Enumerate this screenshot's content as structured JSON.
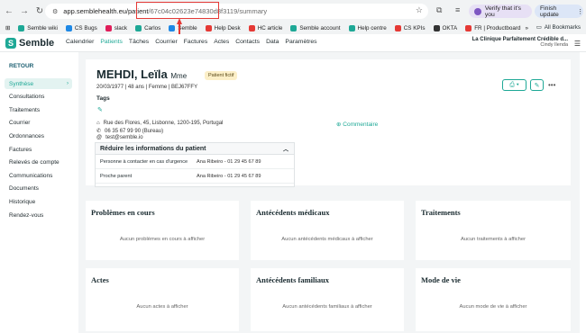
{
  "browser": {
    "url_host": "app.semblehealth.eu/patient",
    "url_path": "/67c04c02623e74830d8f3119/summary",
    "verify_label": "Verify that it's you",
    "finish_label": "Finish update",
    "bookmarks": [
      {
        "label": "Semble wiki",
        "color": "#1ea896"
      },
      {
        "label": "CS Bugs",
        "color": "#1e88e5"
      },
      {
        "label": "slack",
        "color": "#e01e5a"
      },
      {
        "label": "Carlos",
        "color": "#1ea896"
      },
      {
        "label": "Semble",
        "color": "#1e88e5"
      },
      {
        "label": "Help Desk",
        "color": "#e53935"
      },
      {
        "label": "HC article",
        "color": "#e53935"
      },
      {
        "label": "Semble account",
        "color": "#1ea896"
      },
      {
        "label": "Help centre",
        "color": "#1ea896"
      },
      {
        "label": "CS KPIs",
        "color": "#e53935"
      },
      {
        "label": "OKTA",
        "color": "#333333"
      },
      {
        "label": "FR | Productboard",
        "color": "#e53935"
      }
    ],
    "all_bookmarks": "All Bookmarks"
  },
  "app": {
    "logo": "Semble",
    "nav": [
      "Calendrier",
      "Patients",
      "Tâches",
      "Courrier",
      "Factures",
      "Actes",
      "Contacts",
      "Data",
      "Paramètres"
    ],
    "active_nav": "Patients",
    "clinic_name": "La Clinique Parfaitement Crédible d...",
    "clinic_user": "Cindy Ilenda"
  },
  "sidebar": {
    "title": "RETOUR",
    "items": [
      "Synthèse",
      "Consultations",
      "Traitements",
      "Courrier",
      "Ordonnances",
      "Factures",
      "Relevés de compte",
      "Communications",
      "Documents",
      "Historique",
      "Rendez-vous"
    ],
    "active": "Synthèse"
  },
  "patient": {
    "name": "MEHDI, Leïla",
    "title": "Mme",
    "badge": "Patient fictif",
    "meta": "20/03/1977  |  48 ans  |  Femme  |  BEJ67FFY",
    "tags_label": "Tags",
    "address": "Rue des Flores, 45, Lisbonne, 1200-195, Portugal",
    "phone": "06 35 67 99 90 (Bureau)",
    "email": "test@semble.io",
    "comment_link": "Commentaire",
    "reduce_title": "Réduire les informations du patient",
    "contacts": [
      {
        "label": "Personne à contacter en cas d'urgence",
        "value": "Ana Ribeiro - 01 29 45 67 89"
      },
      {
        "label": "Proche parent",
        "value": "Ana Ribeiro - 01 29 45 67 89"
      }
    ]
  },
  "tiles": [
    {
      "title": "Problèmes en cours",
      "empty": "Aucun problèmes en cours à afficher"
    },
    {
      "title": "Antécédents médicaux",
      "empty": "Aucun antécédents médicaux à afficher"
    },
    {
      "title": "Traitements",
      "empty": "Aucun traitements à afficher"
    },
    {
      "title": "Actes",
      "empty": "Aucun actes à afficher"
    },
    {
      "title": "Antécédents familiaux",
      "empty": "Aucun antécédents familiaux à afficher"
    },
    {
      "title": "Mode de vie",
      "empty": "Aucun mode de vie à afficher"
    }
  ]
}
